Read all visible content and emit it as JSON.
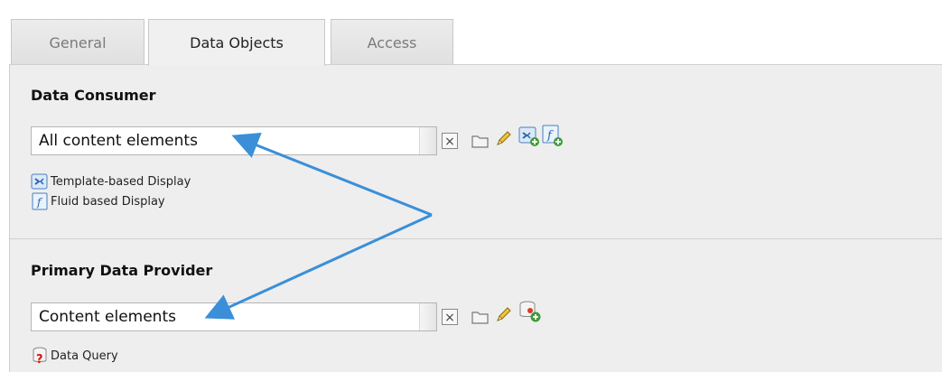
{
  "tabs": [
    {
      "label": "General",
      "active": false
    },
    {
      "label": "Data Objects",
      "active": true
    },
    {
      "label": "Access",
      "active": false
    }
  ],
  "consumer": {
    "title": "Data Consumer",
    "selected_value": "All content elements",
    "wizards": [
      {
        "label": "Template-based Display",
        "icon": "template-display-icon"
      },
      {
        "label": "Fluid based Display",
        "icon": "fluid-display-icon"
      }
    ]
  },
  "provider": {
    "title": "Primary Data Provider",
    "selected_value": "Content elements",
    "wizards": [
      {
        "label": "Data Query",
        "icon": "data-query-icon"
      }
    ]
  },
  "colors": {
    "annotation_arrow": "#3a8fd8",
    "section_bg": "#eeeeee"
  }
}
